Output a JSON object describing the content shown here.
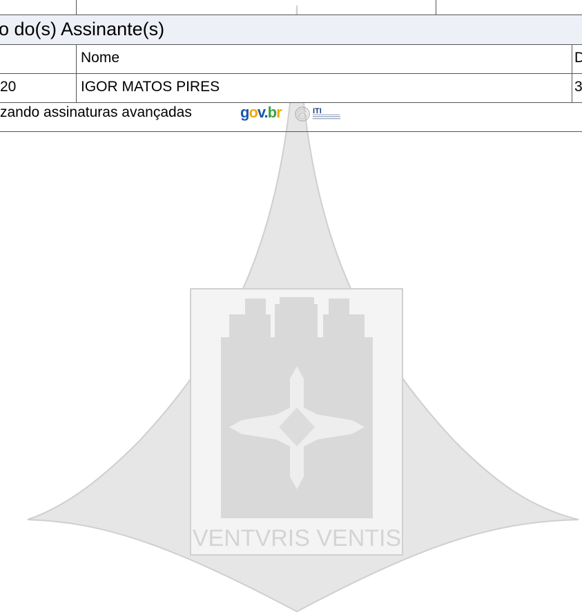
{
  "table": {
    "title": "o do(s) Assinante(s)",
    "header": {
      "col_id": "",
      "col_name": "Nome",
      "col_date": "D"
    },
    "rows": [
      {
        "id": "20",
        "name": "IGOR MATOS PIRES",
        "date": "3"
      }
    ],
    "footer_text": "zando assinaturas avançadas"
  },
  "logos": {
    "govbr": "gov.br",
    "iti": "ITI"
  },
  "watermark": {
    "motto": "VENTVRIS VENTIS"
  },
  "colors": {
    "title_bg": "#eef0f8",
    "border": "#555555",
    "govbr_blue": "#1a58a8",
    "govbr_yellow": "#f2a900",
    "govbr_green": "#39a33a",
    "watermark_fill": "#e2e2e2"
  }
}
